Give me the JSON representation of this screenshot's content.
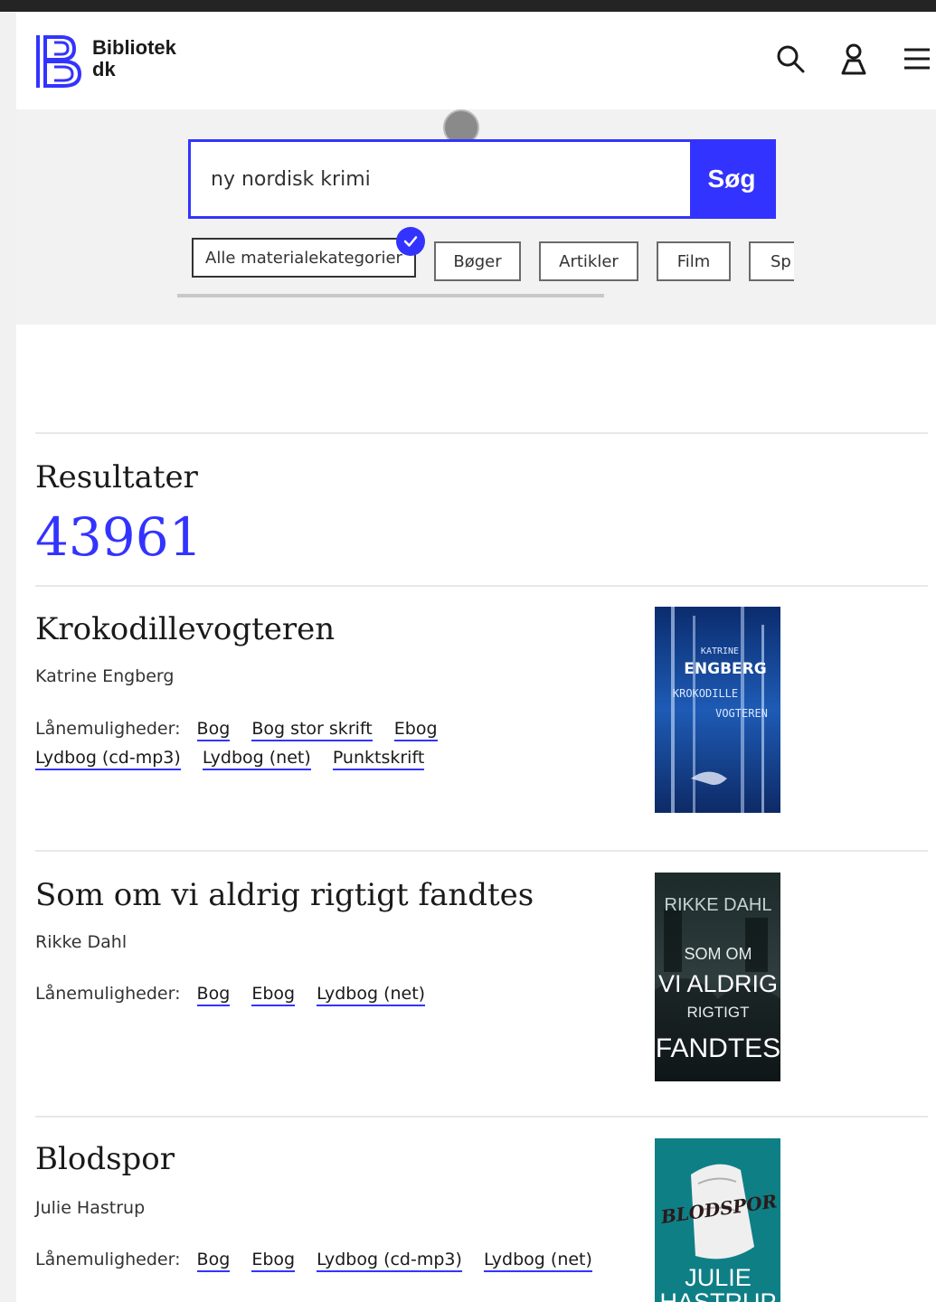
{
  "header": {
    "logo_line1": "Bibliotek",
    "logo_line2": "dk"
  },
  "search": {
    "query": "ny nordisk krimi",
    "button_label": "Søg"
  },
  "filters": [
    "Alle materialekategorier",
    "Bøger",
    "Artikler",
    "Film",
    "Sp"
  ],
  "results": {
    "label": "Resultater",
    "count": "43961"
  },
  "loan_label": "Lånemuligheder:",
  "items": [
    {
      "title": "Krokodillevogteren",
      "author": "Katrine Engberg",
      "loans": [
        "Bog",
        "Bog stor skrift",
        "Ebog",
        "Lydbog (cd-mp3)",
        "Lydbog (net)",
        "Punktskrift"
      ],
      "cover_text": [
        "KATRINE",
        "ENGBERG",
        "KROKODILLE",
        "VOGTEREN"
      ]
    },
    {
      "title": "Som om vi aldrig rigtigt fandtes",
      "author": "Rikke Dahl",
      "loans": [
        "Bog",
        "Ebog",
        "Lydbog (net)"
      ],
      "cover_text": [
        "RIKKE DAHL",
        "SOM OM",
        "VI ALDRIG",
        "RIGTIGT",
        "FANDTES"
      ]
    },
    {
      "title": "Blodspor",
      "author": "Julie Hastrup",
      "loans": [
        "Bog",
        "Ebog",
        "Lydbog (cd-mp3)",
        "Lydbog (net)"
      ],
      "cover_text": [
        "BLODSPOR",
        "JULIE",
        "HASTRUP"
      ]
    }
  ],
  "colors": {
    "accent": "#3333ff",
    "topbar": "#242424",
    "search_bg": "#f2f2f2"
  }
}
